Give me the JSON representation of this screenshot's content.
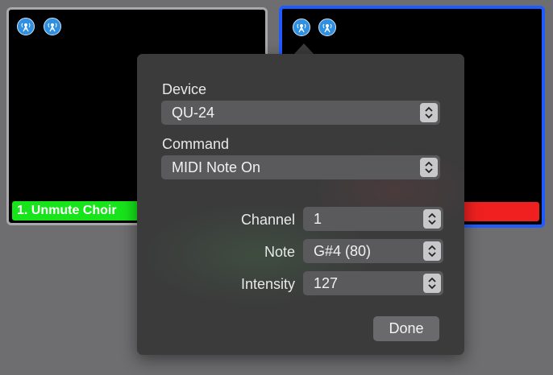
{
  "cues": {
    "left": {
      "label": "1. Unmute Choir"
    }
  },
  "popover": {
    "device": {
      "label": "Device",
      "value": "QU-24"
    },
    "command": {
      "label": "Command",
      "value": "MIDI Note On"
    },
    "channel": {
      "label": "Channel",
      "value": "1"
    },
    "note": {
      "label": "Note",
      "value": "G#4 (80)"
    },
    "intensity": {
      "label": "Intensity",
      "value": "127"
    },
    "done_label": "Done"
  },
  "colors": {
    "cue_left_bar": "#17e41a",
    "cue_right_bar": "#f02020",
    "selected_border": "#1f5cff"
  },
  "icons": [
    "antenna-icon",
    "stepper-icon"
  ]
}
